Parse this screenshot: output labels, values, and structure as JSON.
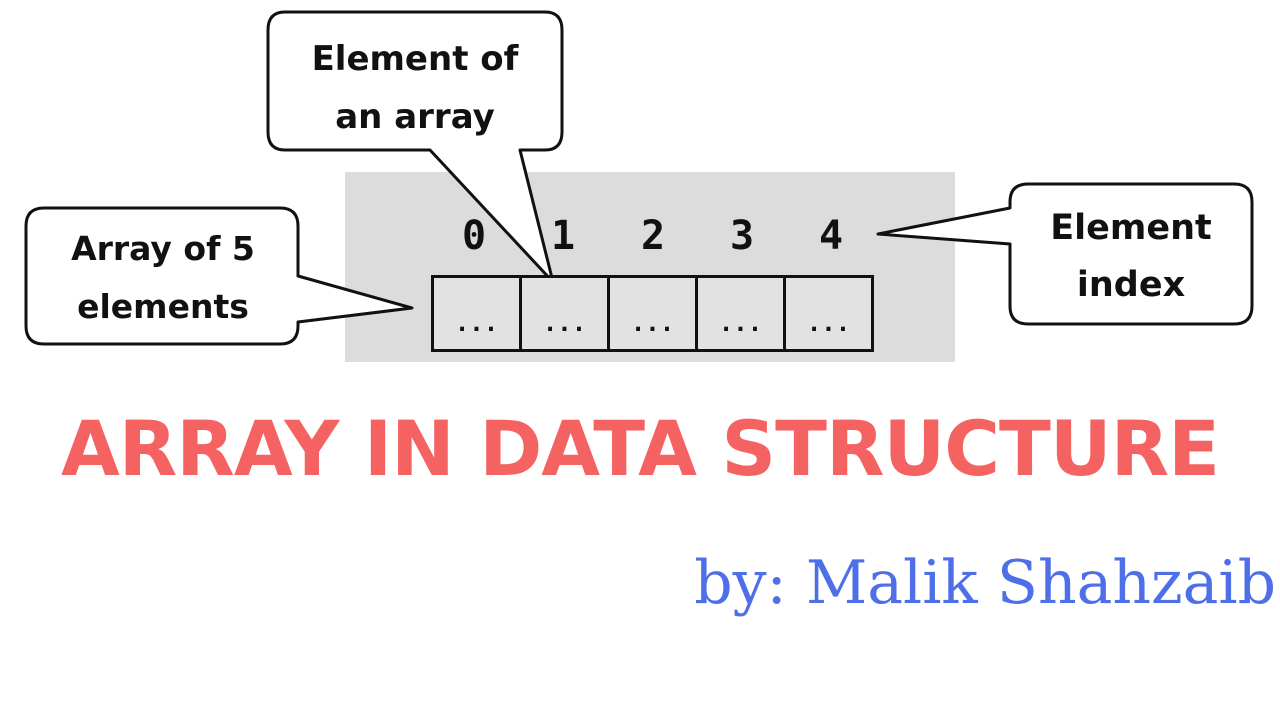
{
  "diagram": {
    "indices": [
      "0",
      "1",
      "2",
      "3",
      "4"
    ],
    "cells": [
      "...",
      "...",
      "...",
      "...",
      "..."
    ],
    "callouts": {
      "element_line1": "Element of",
      "element_line2": "an array",
      "array_line1": "Array of 5",
      "array_line2": "elements",
      "index_line1": "Element",
      "index_line2": "index"
    }
  },
  "title": "ARRAY IN DATA STRUCTURE",
  "author": "by: Malik Shahzaib",
  "colors": {
    "title": "#f56262",
    "author": "#4f6fe8",
    "panel": "#dcdcdc"
  }
}
